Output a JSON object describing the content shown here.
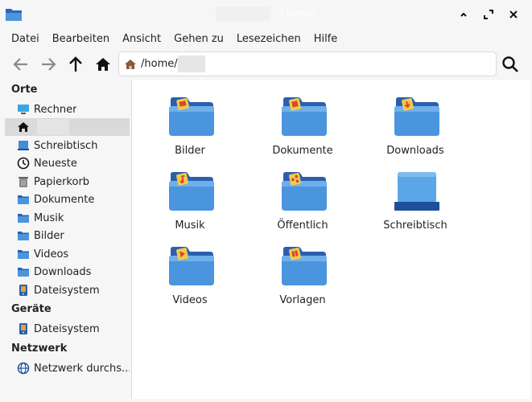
{
  "window": {
    "title": "- Thunar"
  },
  "menubar": {
    "items": [
      "Datei",
      "Bearbeiten",
      "Ansicht",
      "Gehen zu",
      "Lesezeichen",
      "Hilfe"
    ]
  },
  "location": {
    "path": "/home/"
  },
  "sidebar": {
    "sections": {
      "places": "Orte",
      "devices": "Geräte",
      "network": "Netzwerk"
    },
    "places": [
      {
        "label": "Rechner",
        "icon": "computer-icon"
      },
      {
        "label": "",
        "icon": "home-icon",
        "selected": true
      },
      {
        "label": "Schreibtisch",
        "icon": "desktop-icon"
      },
      {
        "label": "Neueste",
        "icon": "clock-icon"
      },
      {
        "label": "Papierkorb",
        "icon": "trash-icon"
      },
      {
        "label": "Dokumente",
        "icon": "folder-icon"
      },
      {
        "label": "Musik",
        "icon": "folder-icon"
      },
      {
        "label": "Bilder",
        "icon": "folder-icon"
      },
      {
        "label": "Videos",
        "icon": "folder-icon"
      },
      {
        "label": "Downloads",
        "icon": "folder-icon"
      },
      {
        "label": "Dateisystem",
        "icon": "drive-icon"
      }
    ],
    "devices": [
      {
        "label": "Dateisystem",
        "icon": "drive-icon"
      }
    ],
    "network": [
      {
        "label": "Netzwerk durchs...",
        "icon": "globe-icon"
      }
    ]
  },
  "files": [
    {
      "label": "Bilder",
      "icon": "pictures-folder-icon"
    },
    {
      "label": "Dokumente",
      "icon": "documents-folder-icon"
    },
    {
      "label": "Downloads",
      "icon": "downloads-folder-icon"
    },
    {
      "label": "Musik",
      "icon": "music-folder-icon"
    },
    {
      "label": "Öffentlich",
      "icon": "public-folder-icon"
    },
    {
      "label": "Schreibtisch",
      "icon": "desktop-folder-icon"
    },
    {
      "label": "Videos",
      "icon": "videos-folder-icon"
    },
    {
      "label": "Vorlagen",
      "icon": "templates-folder-icon"
    }
  ],
  "colors": {
    "folder_blue": "#3f8ed8",
    "folder_back": "#2b66b8",
    "emblem_yellow": "#f2c94c",
    "emblem_red": "#d9462e",
    "selection": "#dadada"
  }
}
